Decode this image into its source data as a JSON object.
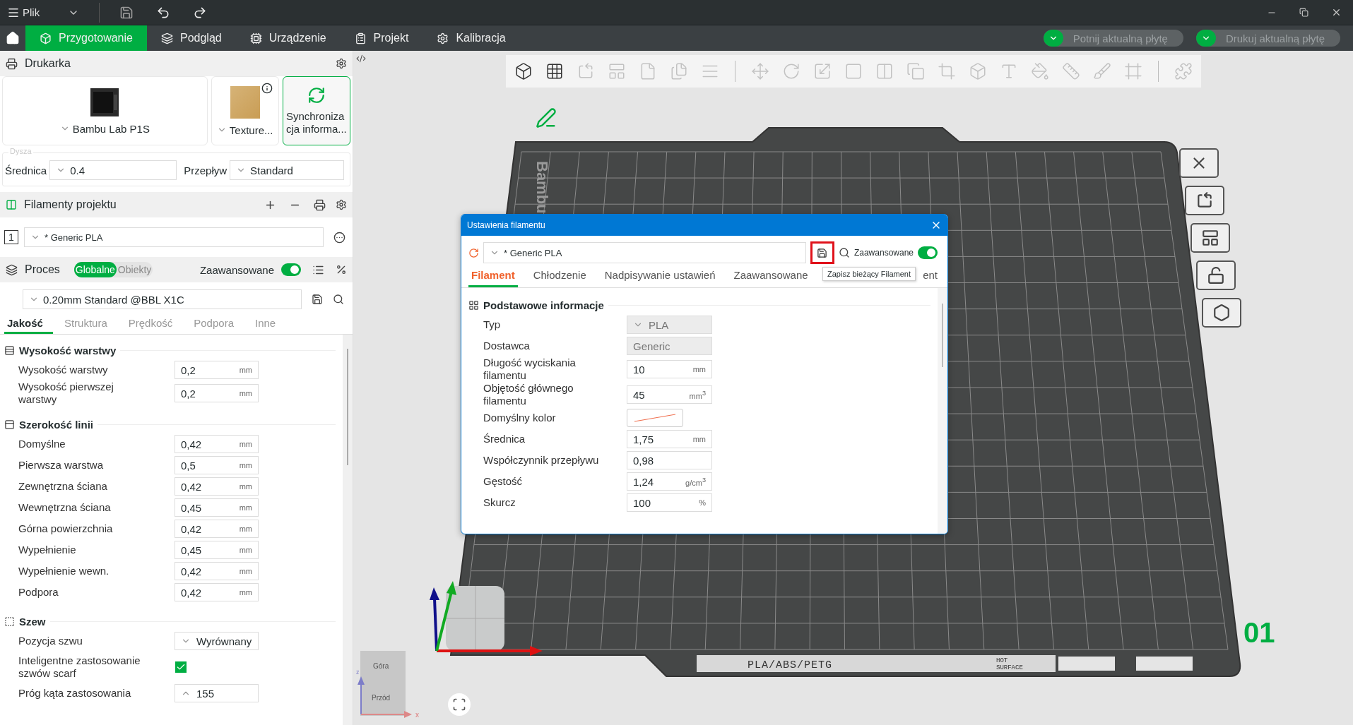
{
  "titlebar": {
    "menu": "Plik"
  },
  "nav": {
    "tabs": [
      {
        "label": "Przygotowanie",
        "selected": true,
        "kind": "cube"
      },
      {
        "label": "Podgląd",
        "selected": false,
        "kind": "layers"
      },
      {
        "label": "Urządzenie",
        "selected": false,
        "kind": "device"
      },
      {
        "label": "Projekt",
        "selected": false,
        "kind": "project"
      },
      {
        "label": "Kalibracja",
        "selected": false,
        "kind": "gear"
      }
    ],
    "actions": [
      "Potnij aktualną płytę",
      "Drukuj aktualną płytę"
    ]
  },
  "printer": {
    "title": "Drukarka",
    "name": "Bambu Lab P1S",
    "plate": "Texture...",
    "sync": "Synchronizacja informa..."
  },
  "nozzle": {
    "legend": "Dysza",
    "diameter_label": "Średnica",
    "diameter": "0.4",
    "flow_label": "Przepływ",
    "flow": "Standard"
  },
  "filaments": {
    "title": "Filamenty projektu",
    "items": [
      {
        "index": "1",
        "name": "* Generic PLA"
      }
    ]
  },
  "process": {
    "title": "Proces",
    "scopes": [
      {
        "label": "Globalne",
        "selected": true
      },
      {
        "label": "Obiekty",
        "selected": false
      }
    ],
    "advanced_label": "Zaawansowane",
    "advanced": true,
    "preset": "0.20mm Standard @BBL X1C",
    "tabs": [
      {
        "label": "Jakość",
        "selected": true
      },
      {
        "label": "Struktura",
        "selected": false
      },
      {
        "label": "Prędkość",
        "selected": false
      },
      {
        "label": "Podpora",
        "selected": false
      },
      {
        "label": "Inne",
        "selected": false
      }
    ],
    "groups": [
      {
        "title": "Wysokość warstwy",
        "kind": "layers",
        "rows": [
          {
            "label": "Wysokość warstwy",
            "kind": "number",
            "value": "0,2",
            "unit": "mm"
          },
          {
            "label": "Wysokość pierwszej warstwy",
            "kind": "number",
            "value": "0,2",
            "unit": "mm"
          }
        ]
      },
      {
        "title": "Szerokość linii",
        "kind": "width",
        "rows": [
          {
            "label": "Domyślne",
            "kind": "number",
            "value": "0,42",
            "unit": "mm"
          },
          {
            "label": "Pierwsza warstwa",
            "kind": "number",
            "value": "0,5",
            "unit": "mm"
          },
          {
            "label": "Zewnętrzna ściana",
            "kind": "number",
            "value": "0,42",
            "unit": "mm"
          },
          {
            "label": "Wewnętrzna ściana",
            "kind": "number",
            "value": "0,45",
            "unit": "mm"
          },
          {
            "label": "Górna powierzchnia",
            "kind": "number",
            "value": "0,42",
            "unit": "mm"
          },
          {
            "label": "Wypełnienie",
            "kind": "number",
            "value": "0,45",
            "unit": "mm"
          },
          {
            "label": "Wypełnienie wewn.",
            "kind": "number",
            "value": "0,42",
            "unit": "mm"
          },
          {
            "label": "Podpora",
            "kind": "number",
            "value": "0,42",
            "unit": "mm"
          }
        ]
      },
      {
        "title": "Szew",
        "kind": "seam",
        "rows": [
          {
            "label": "Pozycja szwu",
            "kind": "select",
            "value": "Wyrównany"
          },
          {
            "label": "Inteligentne zastosowanie szwów scarf",
            "kind": "checkbox",
            "checked": true
          },
          {
            "label": "Próg kąta zastosowania",
            "kind": "spin",
            "value": "155"
          }
        ]
      }
    ]
  },
  "viewport": {
    "plate_brand": "Bambu",
    "materials": "PLA/ABS/PETG",
    "warning": [
      "HOT",
      "SURFACE"
    ],
    "plate_number": "01",
    "view_cube": {
      "top": "Góra",
      "front": "Przód"
    },
    "axes": [
      "z",
      "x"
    ],
    "toolbar": [
      {
        "kind": "cube",
        "disabled": false
      },
      {
        "kind": "grid",
        "disabled": false
      },
      {
        "kind": "tilt",
        "disabled": true
      },
      {
        "kind": "layout",
        "disabled": true
      },
      {
        "kind": "file",
        "disabled": true
      },
      {
        "kind": "files",
        "disabled": true
      },
      {
        "kind": "lines",
        "disabled": true,
        "separator": true
      },
      {
        "kind": "move",
        "disabled": true
      },
      {
        "kind": "rotate",
        "disabled": true
      },
      {
        "kind": "scale",
        "disabled": true
      },
      {
        "kind": "square",
        "disabled": true
      },
      {
        "kind": "split",
        "disabled": true
      },
      {
        "kind": "copy",
        "disabled": true
      },
      {
        "kind": "crop",
        "disabled": true
      },
      {
        "kind": "box",
        "disabled": true
      },
      {
        "kind": "text",
        "disabled": true
      },
      {
        "kind": "bucket",
        "disabled": true
      },
      {
        "kind": "ruler",
        "disabled": true
      },
      {
        "kind": "brush",
        "disabled": true
      },
      {
        "kind": "frame",
        "disabled": true,
        "separator": true
      },
      {
        "kind": "puzzle",
        "disabled": true
      }
    ]
  },
  "dialog": {
    "title": "Ustawienia filamentu",
    "preset": "* Generic PLA",
    "advanced_label": "Zaawansowane",
    "advanced": true,
    "tooltip": "Zapisz bieżący Filament",
    "tabs": [
      {
        "label": "Filament",
        "selected": true
      },
      {
        "label": "Chłodzenie",
        "selected": false
      },
      {
        "label": "Nadpisywanie ustawień",
        "selected": false
      },
      {
        "label": "Zaawansowane",
        "selected": false
      },
      {
        "label": "ent",
        "selected": false
      }
    ],
    "section": "Podstawowe informacje",
    "rows": [
      {
        "label": "Typ",
        "kind": "select",
        "value": "PLA",
        "disabled": true
      },
      {
        "label": "Dostawca",
        "kind": "text",
        "value": "Generic",
        "disabled": true
      },
      {
        "label": "Długość wyciskania filamentu",
        "kind": "number",
        "value": "10",
        "unit": "mm",
        "disabled": false
      },
      {
        "label": "Objętość głównego filamentu",
        "kind": "number",
        "value": "45",
        "unit": "mm$^{3}$",
        "disabled": false
      },
      {
        "label": "Domyślny kolor",
        "kind": "color",
        "disabled": false
      },
      {
        "label": "Średnica",
        "kind": "number",
        "value": "1,75",
        "unit": "mm",
        "disabled": false
      },
      {
        "label": "Współczynnik przepływu",
        "kind": "number",
        "value": "0,98",
        "disabled": false
      },
      {
        "label": "Gęstość",
        "kind": "number",
        "value": "1,24",
        "unit": "g/cm$^{3}$",
        "disabled": false
      },
      {
        "label": "Skurcz",
        "kind": "number",
        "value": "100",
        "unit": "%",
        "disabled": false
      }
    ]
  }
}
